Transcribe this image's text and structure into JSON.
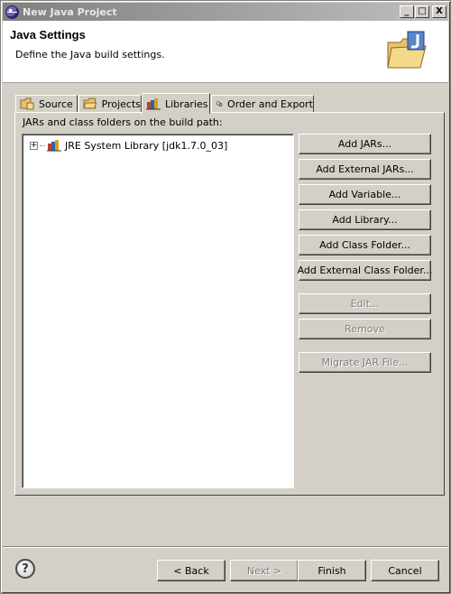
{
  "window": {
    "title": "New Java Project",
    "controls": {
      "minimize": "_",
      "maximize": "□",
      "close": "X"
    }
  },
  "banner": {
    "heading": "Java Settings",
    "description": "Define the Java build settings.",
    "image_icon": "wizard-folder-java-icon"
  },
  "tabs": [
    {
      "label": "Source",
      "icon": "source-folder-icon",
      "active": false
    },
    {
      "label": "Projects",
      "icon": "projects-folder-icon",
      "active": false
    },
    {
      "label": "Libraries",
      "icon": "libraries-icon",
      "active": true
    },
    {
      "label": "Order and Export",
      "icon": "order-export-icon",
      "active": false
    }
  ],
  "libraries": {
    "panel_label": "JARs and class folders on the build path:",
    "tree_items": [
      {
        "label": "JRE System Library [jdk1.7.0_03]",
        "expander": "+",
        "icon": "library-icon"
      }
    ],
    "buttons": [
      {
        "label": "Add JARs...",
        "enabled": true
      },
      {
        "label": "Add External JARs...",
        "enabled": true
      },
      {
        "label": "Add Variable...",
        "enabled": true
      },
      {
        "label": "Add Library...",
        "enabled": true
      },
      {
        "label": "Add Class Folder...",
        "enabled": true
      },
      {
        "label": "Add External Class Folder...",
        "enabled": true
      },
      {
        "label": "Edit...",
        "enabled": false
      },
      {
        "label": "Remove",
        "enabled": false
      },
      {
        "label": "Migrate JAR File...",
        "enabled": false
      }
    ]
  },
  "footer": {
    "help_label": "?",
    "back_label": "< Back",
    "next_label": "Next >",
    "finish_label": "Finish",
    "cancel_label": "Cancel",
    "next_enabled": false
  },
  "colors": {
    "dialog_bg": "#d4d0c8",
    "title_inactive_start": "#808080",
    "disabled_text": "#808080"
  }
}
